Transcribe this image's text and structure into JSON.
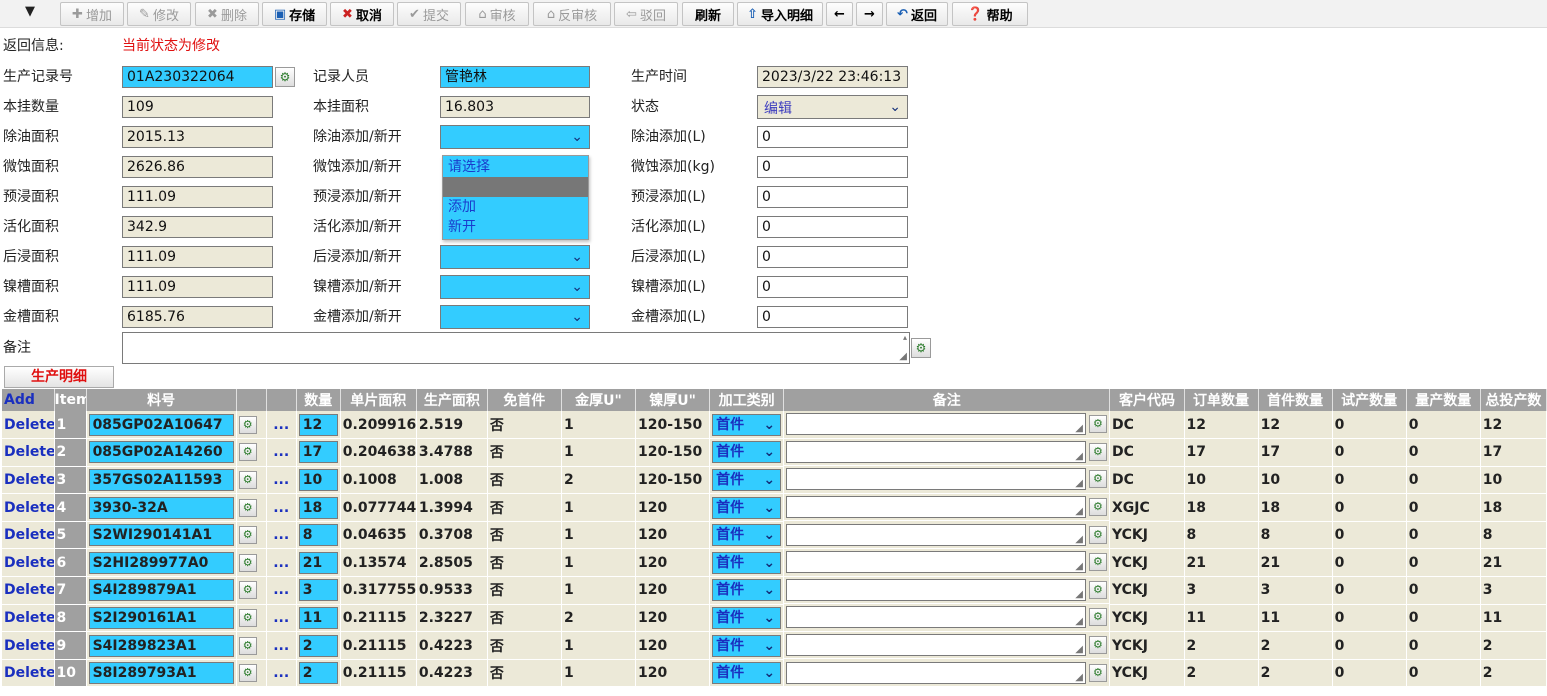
{
  "toolbar": {
    "toggle": "▼",
    "buttons": [
      {
        "key": "add",
        "label": "增加",
        "icon": "plus-icon",
        "enabled": false
      },
      {
        "key": "edit",
        "label": "修改",
        "icon": "edit-icon",
        "enabled": false
      },
      {
        "key": "delete",
        "label": "删除",
        "icon": "delete-icon",
        "enabled": false
      },
      {
        "key": "save",
        "label": "存储",
        "icon": "save-icon",
        "enabled": true
      },
      {
        "key": "cancel",
        "label": "取消",
        "icon": "cancel-icon",
        "enabled": true
      },
      {
        "key": "submit",
        "label": "提交",
        "icon": "check-icon",
        "enabled": false
      },
      {
        "key": "audit",
        "label": "审核",
        "icon": "audit-icon",
        "enabled": false
      },
      {
        "key": "unaudit",
        "label": "反审核",
        "icon": "unaudit-icon",
        "enabled": false
      },
      {
        "key": "reject",
        "label": "驳回",
        "icon": "reject-icon",
        "enabled": false
      },
      {
        "key": "refresh",
        "label": "刷新",
        "icon": "",
        "enabled": true
      },
      {
        "key": "import",
        "label": "导入明细",
        "icon": "import-icon",
        "enabled": true
      },
      {
        "key": "back",
        "label": "",
        "icon": "arrow-left-icon",
        "enabled": true
      },
      {
        "key": "forward",
        "label": "",
        "icon": "arrow-right-icon",
        "enabled": true
      },
      {
        "key": "return",
        "label": "返回",
        "icon": "return-icon",
        "enabled": true
      },
      {
        "key": "help",
        "label": "帮助",
        "icon": "help-icon",
        "enabled": true
      }
    ]
  },
  "form": {
    "return_info_label": "返回信息:",
    "return_info_value": "当前状态为修改",
    "record_no_label": "生产记录号",
    "record_no_value": "01A230322064",
    "recorder_label": "记录人员",
    "recorder_value": "管艳林",
    "prod_time_label": "生产时间",
    "prod_time_value": "2023/3/22 23:46:13",
    "hang_qty_label": "本挂数量",
    "hang_qty_value": "109",
    "hang_area_label": "本挂面积",
    "hang_area_value": "16.803",
    "status_label": "状态",
    "status_value": "编辑",
    "degrease_area_label": "除油面积",
    "degrease_area_value": "2015.13",
    "degrease_sel_label": "除油添加/新开",
    "degrease_add_label": "除油添加(L)",
    "degrease_add_value": "0",
    "microetch_area_label": "微蚀面积",
    "microetch_area_value": "2626.86",
    "microetch_sel_label": "微蚀添加/新开",
    "microetch_add_label": "微蚀添加(kg)",
    "microetch_add_value": "0",
    "predip_area_label": "预浸面积",
    "predip_area_value": "111.09",
    "predip_sel_label": "预浸添加/新开",
    "predip_add_label": "预浸添加(L)",
    "predip_add_value": "0",
    "activate_area_label": "活化面积",
    "activate_area_value": "342.9",
    "activate_sel_label": "活化添加/新开",
    "activate_add_label": "活化添加(L)",
    "activate_add_value": "0",
    "postdip_area_label": "后浸面积",
    "postdip_area_value": "111.09",
    "postdip_sel_label": "后浸添加/新开",
    "postdip_add_label": "后浸添加(L)",
    "postdip_add_value": "0",
    "nickel_area_label": "镍槽面积",
    "nickel_area_value": "111.09",
    "nickel_sel_label": "镍槽添加/新开",
    "nickel_add_label": "镍槽添加(L)",
    "nickel_add_value": "0",
    "gold_area_label": "金槽面积",
    "gold_area_value": "6185.76",
    "gold_sel_label": "金槽添加/新开",
    "gold_add_label": "金槽添加(L)",
    "gold_add_value": "0",
    "remark_label": "备注"
  },
  "dropdown": {
    "options": [
      "请选择",
      "",
      "添加",
      "新开"
    ],
    "highlighted_index": 1
  },
  "detail_tab": "生产明细",
  "grid": {
    "headers": [
      "Add",
      "Item",
      "料号",
      "",
      "数量",
      "单片面积",
      "生产面积",
      "免首件",
      "金厚U\"",
      "镍厚U\"",
      "加工类别",
      "备注",
      "客户代码",
      "订单数量",
      "首件数量",
      "试产数量",
      "量产数量",
      "总投产数"
    ],
    "delete_label": "Delete",
    "dots_label": "...",
    "rows": [
      {
        "item": "1",
        "part": "085GP02A10647",
        "qty": "12",
        "unit_area": "0.209916",
        "prod_area": "2.519",
        "no_first": "否",
        "gold": "1",
        "nickel": "120-150",
        "process": "首件",
        "customer": "DC",
        "order_qty": "12",
        "first_qty": "12",
        "trial_qty": "0",
        "mass_qty": "0",
        "total_qty": "12"
      },
      {
        "item": "2",
        "part": "085GP02A14260",
        "qty": "17",
        "unit_area": "0.204638",
        "prod_area": "3.4788",
        "no_first": "否",
        "gold": "1",
        "nickel": "120-150",
        "process": "首件",
        "customer": "DC",
        "order_qty": "17",
        "first_qty": "17",
        "trial_qty": "0",
        "mass_qty": "0",
        "total_qty": "17"
      },
      {
        "item": "3",
        "part": "357GS02A11593",
        "qty": "10",
        "unit_area": "0.1008",
        "prod_area": "1.008",
        "no_first": "否",
        "gold": "2",
        "nickel": "120-150",
        "process": "首件",
        "customer": "DC",
        "order_qty": "10",
        "first_qty": "10",
        "trial_qty": "0",
        "mass_qty": "0",
        "total_qty": "10"
      },
      {
        "item": "4",
        "part": "3930-32A",
        "qty": "18",
        "unit_area": "0.077744",
        "prod_area": "1.3994",
        "no_first": "否",
        "gold": "1",
        "nickel": "120",
        "process": "首件",
        "customer": "XGJC",
        "order_qty": "18",
        "first_qty": "18",
        "trial_qty": "0",
        "mass_qty": "0",
        "total_qty": "18"
      },
      {
        "item": "5",
        "part": "S2WI290141A1",
        "qty": "8",
        "unit_area": "0.04635",
        "prod_area": "0.3708",
        "no_first": "否",
        "gold": "1",
        "nickel": "120",
        "process": "首件",
        "customer": "YCKJ",
        "order_qty": "8",
        "first_qty": "8",
        "trial_qty": "0",
        "mass_qty": "0",
        "total_qty": "8"
      },
      {
        "item": "6",
        "part": "S2HI289977A0",
        "qty": "21",
        "unit_area": "0.13574",
        "prod_area": "2.8505",
        "no_first": "否",
        "gold": "1",
        "nickel": "120",
        "process": "首件",
        "customer": "YCKJ",
        "order_qty": "21",
        "first_qty": "21",
        "trial_qty": "0",
        "mass_qty": "0",
        "total_qty": "21"
      },
      {
        "item": "7",
        "part": "S4I289879A1",
        "qty": "3",
        "unit_area": "0.317755",
        "prod_area": "0.9533",
        "no_first": "否",
        "gold": "1",
        "nickel": "120",
        "process": "首件",
        "customer": "YCKJ",
        "order_qty": "3",
        "first_qty": "3",
        "trial_qty": "0",
        "mass_qty": "0",
        "total_qty": "3"
      },
      {
        "item": "8",
        "part": "S2I290161A1",
        "qty": "11",
        "unit_area": "0.21115",
        "prod_area": "2.3227",
        "no_first": "否",
        "gold": "2",
        "nickel": "120",
        "process": "首件",
        "customer": "YCKJ",
        "order_qty": "11",
        "first_qty": "11",
        "trial_qty": "0",
        "mass_qty": "0",
        "total_qty": "11"
      },
      {
        "item": "9",
        "part": "S4I289823A1",
        "qty": "2",
        "unit_area": "0.21115",
        "prod_area": "0.4223",
        "no_first": "否",
        "gold": "1",
        "nickel": "120",
        "process": "首件",
        "customer": "YCKJ",
        "order_qty": "2",
        "first_qty": "2",
        "trial_qty": "0",
        "mass_qty": "0",
        "total_qty": "2"
      },
      {
        "item": "10",
        "part": "S8I289793A1",
        "qty": "2",
        "unit_area": "0.21115",
        "prod_area": "0.4223",
        "no_first": "否",
        "gold": "1",
        "nickel": "120",
        "process": "首件",
        "customer": "YCKJ",
        "order_qty": "2",
        "first_qty": "2",
        "trial_qty": "0",
        "mass_qty": "0",
        "total_qty": "2"
      }
    ]
  }
}
